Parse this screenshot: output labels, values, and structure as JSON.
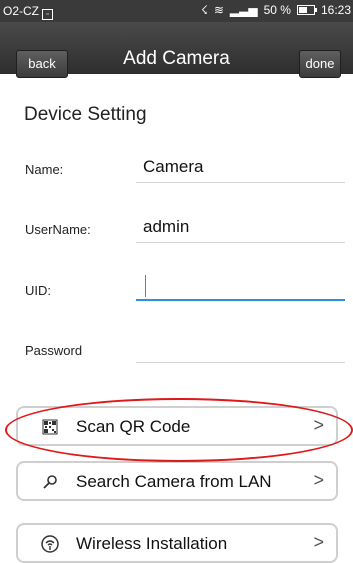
{
  "status_bar": {
    "carrier": "O2-CZ",
    "battery": "50 %",
    "time": "16:23"
  },
  "nav": {
    "back_label": "back",
    "title": "Add Camera",
    "done_label": "done"
  },
  "section_title": "Device Setting",
  "form": {
    "name_label": "Name:",
    "name_value": "Camera",
    "username_label": "UserName:",
    "username_value": "admin",
    "uid_label": "UID:",
    "uid_value": "",
    "password_label": "Password",
    "password_value": ""
  },
  "actions": [
    {
      "label": "Scan QR Code",
      "icon": "qr-code-icon",
      "chevron": ">"
    },
    {
      "label": "Search Camera from LAN",
      "icon": "search-icon",
      "chevron": ">"
    },
    {
      "label": "Wireless Installation",
      "icon": "wireless-icon",
      "chevron": ">"
    }
  ],
  "highlight_color": "#e01818",
  "accent_color": "#2f8ed9"
}
